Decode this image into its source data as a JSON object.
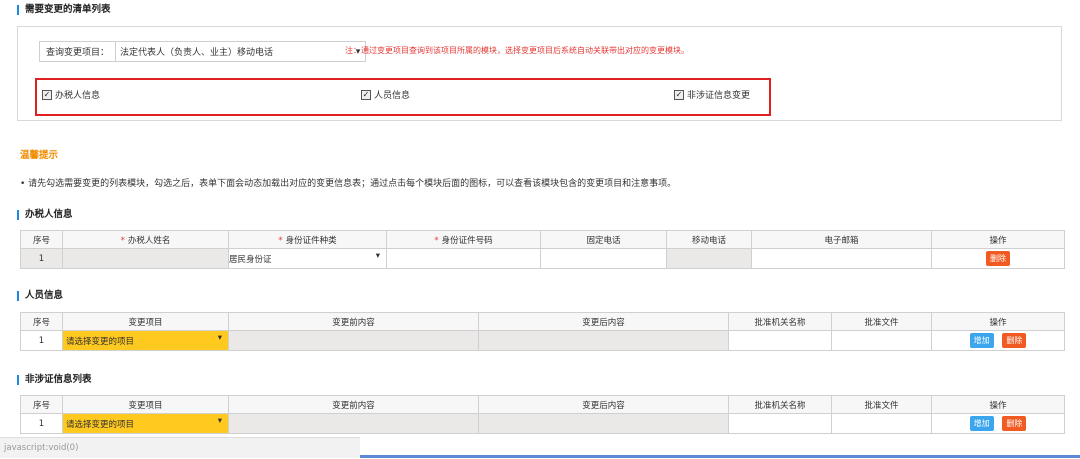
{
  "section_list_title": "需要变更的清单列表",
  "query": {
    "label": "查询变更项目：",
    "value": "法定代表人（负责人、业主）移动电话",
    "chevron": "▾",
    "note": "注：通过变更项目查询到该项目所属的模块，选择变更项目后系统自动关联带出对应的变更模块。"
  },
  "modules": [
    {
      "label": "办税人信息",
      "checked": true
    },
    {
      "label": "人员信息",
      "checked": true
    },
    {
      "label": "非涉证信息变更",
      "checked": true
    }
  ],
  "tips": {
    "title": "温馨提示",
    "text": "•  请先勾选需要变更的列表模块，勾选之后，表单下面会动态加载出对应的变更信息表；通过点击每个模块后面的图标，可以查看该模块包含的变更项目和注意事项。"
  },
  "taxpayer_section": {
    "title": "办税人信息",
    "headers": [
      "序号",
      "办税人姓名",
      "身份证件种类",
      "身份证件号码",
      "固定电话",
      "移动电话",
      "电子邮箱",
      "操作"
    ],
    "required": [
      "",
      "*",
      "*",
      "*",
      "",
      "",
      "",
      ""
    ],
    "row": {
      "index": "1",
      "id_type": "居民身份证",
      "delete_label": "删除"
    }
  },
  "personnel_section": {
    "title": "人员信息",
    "headers": [
      "序号",
      "变更项目",
      "变更前内容",
      "变更后内容",
      "批准机关名称",
      "批准文件",
      "操作"
    ],
    "row": {
      "index": "1",
      "select_placeholder": "请选择变更的项目",
      "add_label": "增加",
      "delete_label": "删除"
    }
  },
  "non_cert_section": {
    "title": "非涉证信息列表",
    "headers": [
      "序号",
      "变更项目",
      "变更前内容",
      "变更后内容",
      "批准机关名称",
      "批准文件",
      "操作"
    ],
    "row": {
      "index": "1",
      "select_placeholder": "请选择变更的项目",
      "add_label": "增加",
      "delete_label": "删除"
    }
  },
  "status_bar": "javascript:void(0)",
  "colors": {
    "accent_blue": "#1e88e5",
    "tip_orange": "#f08c00",
    "alert_red": "#e53935",
    "select_yellow": "#ffc91f"
  }
}
